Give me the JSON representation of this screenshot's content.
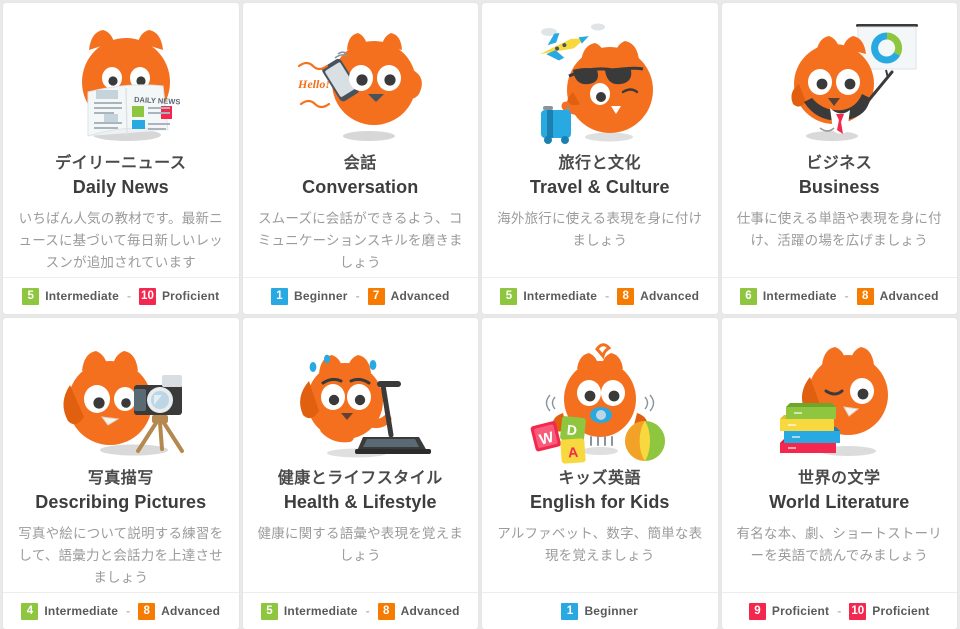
{
  "theme": {
    "card_bg": "#ffffff",
    "page_bg": "#e9e9e9",
    "mascot_orange": "#f4701f",
    "mascot_orange_dark": "#e0600f",
    "title_color": "#4a4a4a",
    "desc_color": "#9b9b9b",
    "level_colors": {
      "beginner": "#29a9e1",
      "intermediate": "#8ec63f",
      "advanced": "#f57c00",
      "proficient": "#f4274f"
    }
  },
  "separator": "-",
  "cards": [
    {
      "icon": "fox-reading-newspaper-icon",
      "title_ja": "デイリーニュース",
      "title_en": "Daily News",
      "description": "いちばん人気の教材です。最新ニュースに基づいて毎日新しいレッスンが追加されています",
      "levels": [
        {
          "number": "5",
          "name": "Intermediate",
          "color": "#8ec63f"
        },
        {
          "number": "10",
          "name": "Proficient",
          "color": "#f4274f"
        }
      ]
    },
    {
      "icon": "fox-phone-hello-icon",
      "title_ja": "会話",
      "title_en": "Conversation",
      "description": "スムーズに会話ができるよう、コミュニケーションスキルを磨きましょう",
      "levels": [
        {
          "number": "1",
          "name": "Beginner",
          "color": "#29a9e1"
        },
        {
          "number": "7",
          "name": "Advanced",
          "color": "#f57c00"
        }
      ]
    },
    {
      "icon": "fox-traveler-suitcase-icon",
      "title_ja": "旅行と文化",
      "title_en": "Travel & Culture",
      "description": "海外旅行に使える表現を身に付けましょう",
      "levels": [
        {
          "number": "5",
          "name": "Intermediate",
          "color": "#8ec63f"
        },
        {
          "number": "8",
          "name": "Advanced",
          "color": "#f57c00"
        }
      ]
    },
    {
      "icon": "fox-business-presentation-icon",
      "title_ja": "ビジネス",
      "title_en": "Business",
      "description": "仕事に使える単語や表現を身に付け、活躍の場を広げましょう",
      "levels": [
        {
          "number": "6",
          "name": "Intermediate",
          "color": "#8ec63f"
        },
        {
          "number": "8",
          "name": "Advanced",
          "color": "#f57c00"
        }
      ]
    },
    {
      "icon": "fox-camera-tripod-icon",
      "title_ja": "写真描写",
      "title_en": "Describing Pictures",
      "description": "写真や絵について説明する練習をして、語彙力と会話力を上達させましょう",
      "levels": [
        {
          "number": "4",
          "name": "Intermediate",
          "color": "#8ec63f"
        },
        {
          "number": "8",
          "name": "Advanced",
          "color": "#f57c00"
        }
      ]
    },
    {
      "icon": "fox-treadmill-running-icon",
      "title_ja": "健康とライフスタイル",
      "title_en": "Health & Lifestyle",
      "description": "健康に関する語彙や表現を覚えましょう",
      "levels": [
        {
          "number": "5",
          "name": "Intermediate",
          "color": "#8ec63f"
        },
        {
          "number": "8",
          "name": "Advanced",
          "color": "#f57c00"
        }
      ]
    },
    {
      "icon": "fox-baby-blocks-ball-icon",
      "title_ja": "キッズ英語",
      "title_en": "English for Kids",
      "description": "アルファベット、数字、簡単な表現を覚えましょう",
      "levels": [
        {
          "number": "1",
          "name": "Beginner",
          "color": "#29a9e1"
        }
      ]
    },
    {
      "icon": "fox-books-stack-icon",
      "title_ja": "世界の文学",
      "title_en": "World Literature",
      "description": "有名な本、劇、ショートストーリーを英語で読んでみましょう",
      "levels": [
        {
          "number": "9",
          "name": "Proficient",
          "color": "#f4274f"
        },
        {
          "number": "10",
          "name": "Proficient",
          "color": "#f4274f"
        }
      ]
    }
  ]
}
